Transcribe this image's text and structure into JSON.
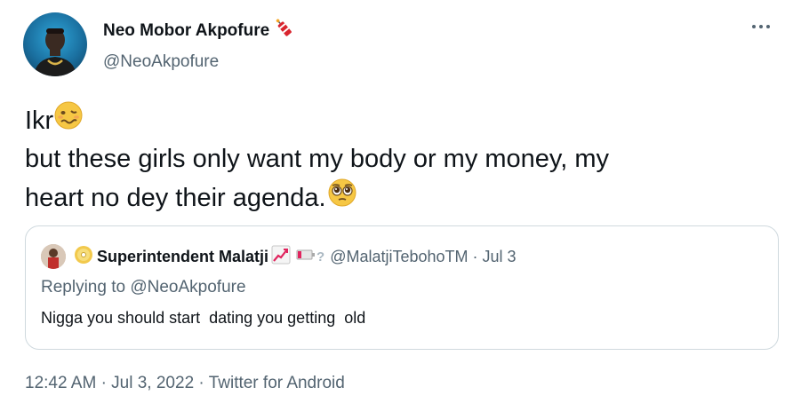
{
  "author": {
    "display_name": "Neo Mobor Akpofure",
    "handle": "@NeoAkpofure",
    "name_emoji": "firecracker-icon"
  },
  "tweet": {
    "line1": "Ikr",
    "line2": "but these girls only want my body or my money, my",
    "line3": "heart no dey their agenda.",
    "line1_emoji": "woozy-face-icon",
    "line3_emoji": "pleading-face-icon"
  },
  "quote": {
    "display_name": "Superintendent Malatji",
    "handle": "@MalatjiTebohoTM",
    "separator": "·",
    "date": "Jul 3",
    "replying_prefix": "Replying to ",
    "replying_to": "@NeoAkpofure",
    "text": "Nigga you should start  dating you getting  old",
    "name_icons": [
      "dvd-icon",
      "chart-increasing-icon",
      "battery-low-icon",
      "question-icon"
    ]
  },
  "meta": {
    "time": "12:42 AM",
    "dot1": "·",
    "date": "Jul 3, 2022",
    "dot2": "·",
    "source": "Twitter for Android"
  },
  "colors": {
    "text_primary": "#0f1419",
    "text_secondary": "#536471",
    "border": "#cfd9de",
    "link": "#536471"
  }
}
